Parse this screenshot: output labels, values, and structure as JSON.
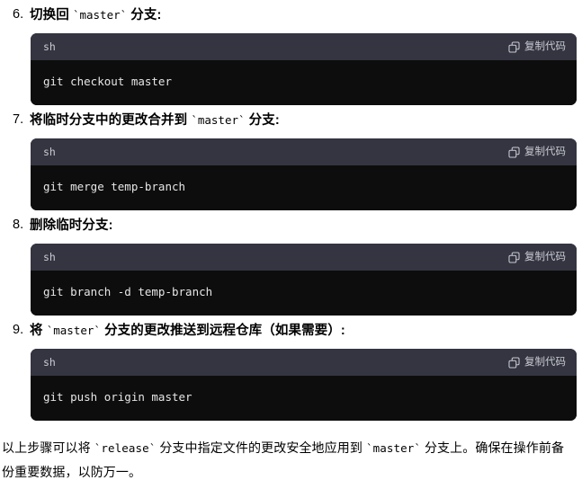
{
  "document": {
    "steps": [
      {
        "number": "6.",
        "text_before": "切换回 ",
        "code_inline": "`master`",
        "text_after": " 分支:",
        "code": {
          "language": "sh",
          "copy_label": "复制代码",
          "copy_icon": "copy-icon",
          "command": "git checkout master"
        }
      },
      {
        "number": "7.",
        "text_before": "将临时分支中的更改合并到 ",
        "code_inline": "`master`",
        "text_after": " 分支:",
        "code": {
          "language": "sh",
          "copy_label": "复制代码",
          "copy_icon": "copy-icon",
          "command": "git merge temp-branch"
        }
      },
      {
        "number": "8.",
        "text_before": "删除临时分支:",
        "code_inline": "",
        "text_after": "",
        "code": {
          "language": "sh",
          "copy_label": "复制代码",
          "copy_icon": "copy-icon",
          "command": "git branch -d temp-branch"
        }
      },
      {
        "number": "9.",
        "text_before": "将 ",
        "code_inline": "`master`",
        "text_after": " 分支的更改推送到远程仓库（如果需要）:",
        "code": {
          "language": "sh",
          "copy_label": "复制代码",
          "copy_icon": "copy-icon",
          "command": "git push origin master"
        }
      }
    ],
    "closing": {
      "part1": "以上步骤可以将 ",
      "code1": "`release`",
      "part2": " 分支中指定文件的更改安全地应用到 ",
      "code2": "`master`",
      "part3": " 分支上。确保在操作前备份重要数据，以防万一。"
    }
  },
  "colors": {
    "page_background": "#ffffff",
    "code_header_background": "#343541",
    "code_body_background": "#0d0d0d",
    "code_text": "#e6e6e6",
    "code_header_text": "#c9cbd1",
    "body_text": "#000000"
  }
}
